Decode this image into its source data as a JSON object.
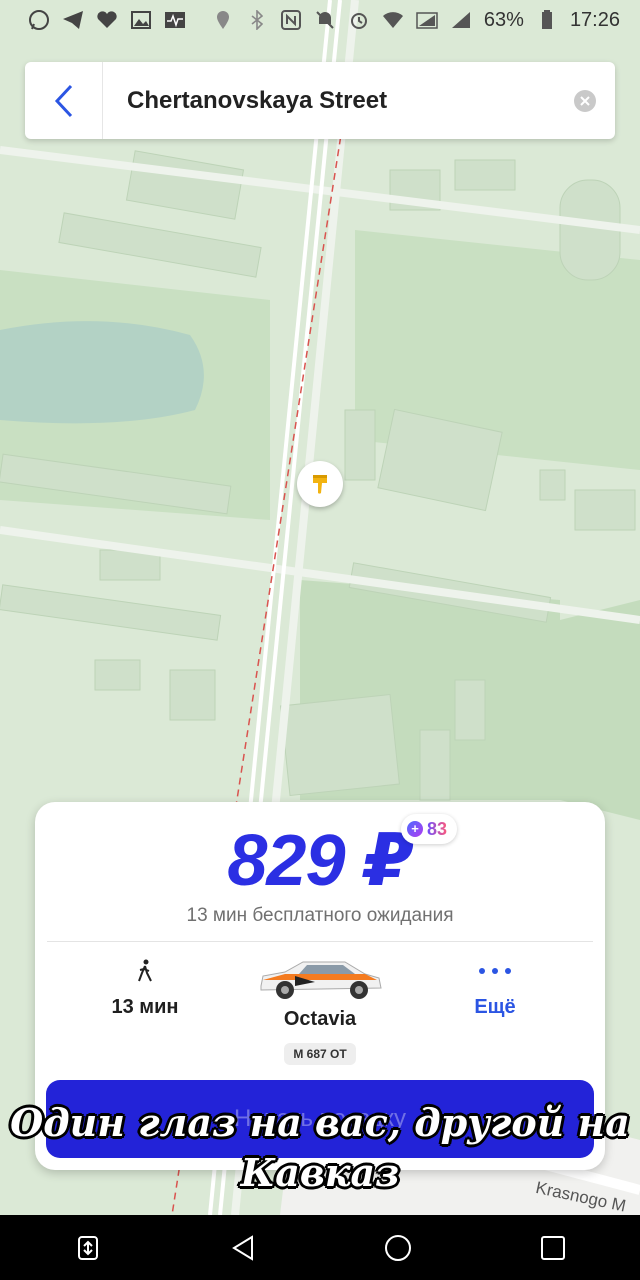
{
  "status_bar": {
    "battery": "63%",
    "time": "17:26",
    "left_icons": [
      "whatsapp-icon",
      "telegram-icon",
      "health-icon",
      "gallery-icon",
      "activity-icon"
    ],
    "right_icons": [
      "location-icon",
      "bluetooth-icon",
      "nfc-icon",
      "mute-icon",
      "alarm-icon",
      "wifi-icon",
      "signal-icon",
      "signal-icon",
      "battery-icon"
    ]
  },
  "search": {
    "value": "Chertanovskaya Street"
  },
  "map": {
    "street_label": "Krasnogo M",
    "colors": {
      "base": "#dbe9d6",
      "park": "#c8dfc1",
      "road": "#eef3ec",
      "route": "#d9534f"
    }
  },
  "ride_card": {
    "price": "829 ₽",
    "plus_points": "83",
    "wait_text": "13 мин бесплатного ожидания",
    "options": {
      "walk_label": "13 мин",
      "car_label": "Octavia",
      "car_plate": "М 687 ОТ",
      "more_label": "Ещё"
    },
    "order_button": "Начать поездку"
  },
  "overlay_caption": {
    "line1": "Один глаз на вас, другой на",
    "line2": "Кавказ"
  },
  "colors": {
    "accent": "#2b2fe3",
    "button": "#2323d8",
    "link": "#2b55e3"
  }
}
